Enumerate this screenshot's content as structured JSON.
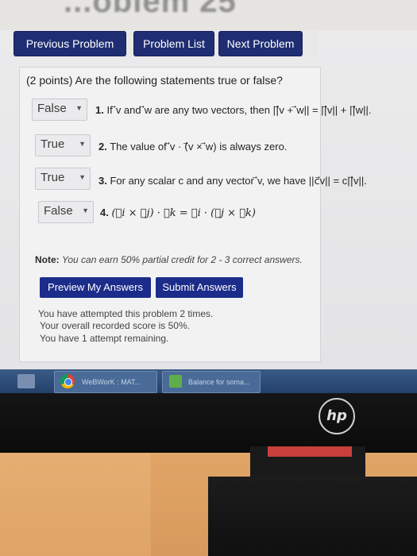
{
  "header": {
    "title_fragment": "...oblem 25"
  },
  "nav": {
    "previous": "Previous Problem",
    "list": "Problem List",
    "next": "Next Problem"
  },
  "question": "(2 points) Are the following statements true or false?",
  "statements": [
    {
      "answer": "False",
      "num": "1.",
      "text": "If ⃗v and ⃗w are any two vectors, then ||⃗v + ⃗w|| = ||⃗v|| + ||⃗w||."
    },
    {
      "answer": "True",
      "num": "2.",
      "text": "The value of ⃗v · (⃗v × ⃗w) is always zero."
    },
    {
      "answer": "True",
      "num": "3.",
      "text": "For any scalar c and any vector ⃗v, we have ||c⃗v|| = c||⃗v||."
    },
    {
      "answer": "False",
      "num": "4.",
      "text": "(⃗i × ⃗j) · ⃗k = ⃗i · (⃗j × ⃗k)"
    }
  ],
  "note": {
    "label": "Note:",
    "text": "You can earn 50% partial credit for 2 - 3 correct answers."
  },
  "actions": {
    "preview": "Preview My Answers",
    "submit": "Submit Answers"
  },
  "status": {
    "attempted": "You have attempted this problem 2 times.",
    "score": "Your overall recorded score is 50%.",
    "remaining": "You have 1 attempt remaining."
  },
  "taskbar": {
    "chrome_label": "WeBWorK : MAT...",
    "balance_label": "Balance for soma..."
  },
  "monitor": {
    "brand": "hp"
  },
  "colors": {
    "nav_button": "#1f2e72",
    "action_button": "#1c2c8a",
    "taskbar": "#2c4a74"
  }
}
